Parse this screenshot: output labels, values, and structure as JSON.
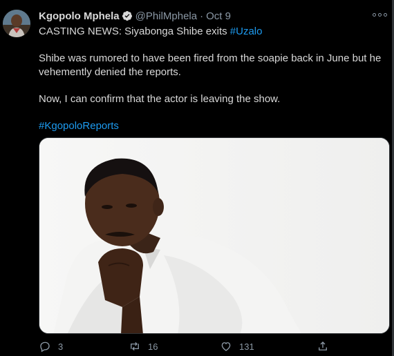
{
  "tweet": {
    "author_name": "Kgopolo Mphela",
    "author_handle": "@PhilMphela",
    "separator": "·",
    "date": "Oct 9",
    "line1_prefix": "CASTING NEWS: Siyabonga Shibe exits ",
    "line1_hashtag": "#Uzalo",
    "paragraph2": "Shibe was rumored to have been fired from the soapie back in June but he vehemently denied the reports.",
    "paragraph3": "Now, I can confirm that the actor is leaving the show.",
    "hashtag2": "#KgopoloReports"
  },
  "actions": {
    "replies": "3",
    "retweets": "16",
    "likes": "131"
  },
  "colors": {
    "background": "#000000",
    "text": "#d9d9d9",
    "muted": "#8b98a5",
    "link": "#1d9bf0",
    "verified": "#d9d9d9"
  },
  "icons": {
    "verified": "verified-badge-icon",
    "more": "more-options-icon",
    "reply": "reply-icon",
    "retweet": "retweet-icon",
    "like": "like-icon",
    "share": "share-icon"
  }
}
